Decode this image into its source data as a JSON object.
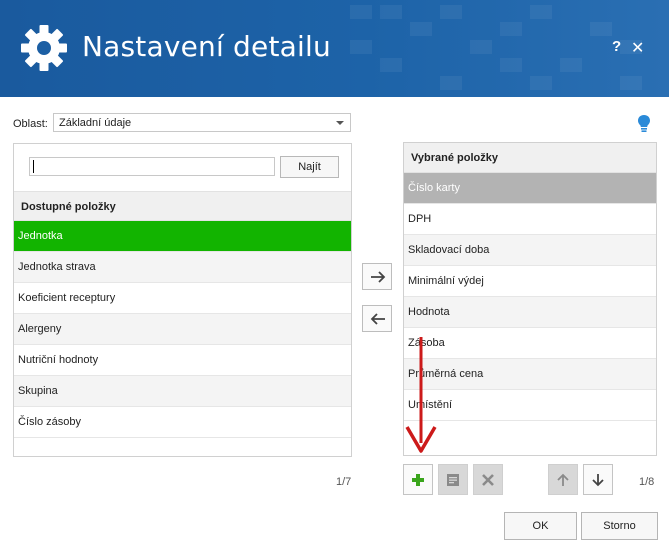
{
  "window": {
    "title": "Nastavení detailu",
    "help_label": "?",
    "close_label": "✕",
    "icon": "gear-icon",
    "header_color": "#1a5a9e"
  },
  "area": {
    "label": "Oblast:",
    "selected": "Základní údaje"
  },
  "search": {
    "value": "",
    "find_label": "Najít"
  },
  "available": {
    "header": "Dostupné položky",
    "items": [
      "Jednotka",
      "Jednotka strava",
      "Koeficient receptury",
      "Alergeny",
      "Nutriční hodnoty",
      "Skupina",
      "Číslo zásoby"
    ],
    "counter": "1/7",
    "selected_color": "#12b400"
  },
  "selected_items": {
    "header": "Vybrané položky",
    "items": [
      "Číslo karty",
      "DPH",
      "Skladovací doba",
      "Minimální výdej",
      "Hodnota",
      "Zásoba",
      "Průměrná cena",
      "Umístění"
    ],
    "counter": "1/8",
    "selected_color": "#b3b3b3"
  },
  "buttons": {
    "ok": "OK",
    "cancel": "Storno"
  },
  "icons": {
    "move_right": "arrow-right-icon",
    "move_left": "arrow-left-icon",
    "add": "plus-icon",
    "edit": "edit-icon",
    "delete": "delete-icon",
    "up": "arrow-up-icon",
    "down": "arrow-down-icon",
    "hint": "lightbulb-icon"
  }
}
